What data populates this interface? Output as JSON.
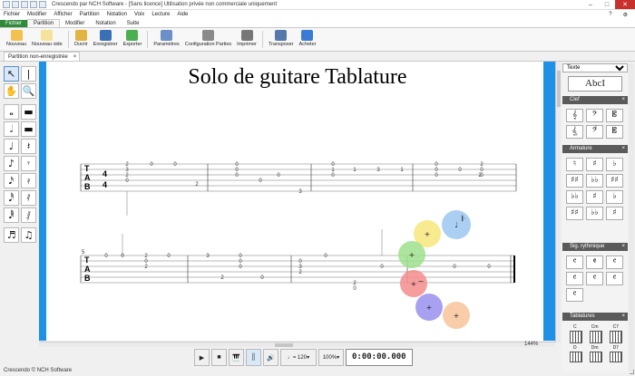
{
  "window": {
    "title": "Crescendo par NCH Software - [Sans licence] Utilisation privée non commerciale uniquement",
    "controls": [
      "–",
      "□",
      "✕"
    ]
  },
  "menubar": [
    "Fichier",
    "Modifier",
    "Afficher",
    "Partition",
    "Notation",
    "Voix",
    "Lecture",
    "Aide"
  ],
  "ribbon_tabs": [
    "Fichier",
    "Partition",
    "Modifier",
    "Notation",
    "Suite"
  ],
  "ribbon_buttons": [
    {
      "label": "Nouveau",
      "icon": "new-doc-icon",
      "color": "#f2c14e"
    },
    {
      "label": "Nouveau vide",
      "icon": "new-blank-icon",
      "color": "#f5e39b"
    },
    {
      "label": "Ouvrir",
      "icon": "open-folder-icon",
      "color": "#e3b341"
    },
    {
      "label": "Enregistrer",
      "icon": "save-icon",
      "color": "#3b6fb6"
    },
    {
      "label": "Exporter",
      "icon": "export-icon",
      "color": "#4caf50"
    },
    {
      "label": "Paramètres",
      "icon": "settings-icon",
      "color": "#6b8fc8"
    },
    {
      "label": "Configuration Parties",
      "icon": "parts-config-icon",
      "color": "#8a8a8a"
    },
    {
      "label": "Imprimer",
      "icon": "print-icon",
      "color": "#777"
    },
    {
      "label": "Transposer",
      "icon": "transpose-icon",
      "color": "#5577aa"
    },
    {
      "label": "Acheter",
      "icon": "buy-icon",
      "color": "#3a7bd5"
    }
  ],
  "document_tab": "Partition non-enregistrée",
  "score": {
    "title": "Solo de guitare Tablature",
    "row2_measure_number": "5",
    "tab_clef": [
      "T",
      "A",
      "B"
    ],
    "time_signature": [
      "4",
      "4"
    ]
  },
  "right_panel": {
    "dropdown": "Texte",
    "text_sample": "AbcI",
    "sections": [
      "Clef",
      "Armature",
      "Sig. rythmique",
      "Tablatures"
    ],
    "chord_labels": [
      "C",
      "Cm",
      "C7",
      "D",
      "Dm",
      "D7"
    ]
  },
  "zoom": "144%",
  "transport": {
    "tempo": "= 120",
    "volume": "100%",
    "time": "0:00:00.000"
  },
  "status": "Crescendo © NCH Software"
}
